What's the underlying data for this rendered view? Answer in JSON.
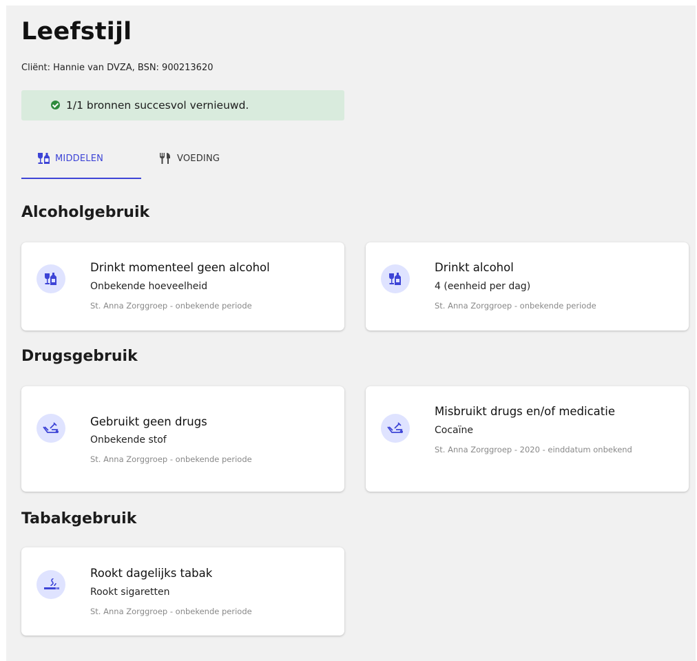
{
  "page": {
    "title": "Leefstijl",
    "client_info": "Cliënt: Hannie van DVZA, BSN: 900213620"
  },
  "alert": {
    "text": "1/1 bronnen succesvol vernieuwd.",
    "icon": "check-circle-icon",
    "color": "#2e8b3d",
    "background": "#d9ebdd"
  },
  "tabs": [
    {
      "label": "MIDDELEN",
      "icon": "bottle-glass-icon",
      "active": true
    },
    {
      "label": "VOEDING",
      "icon": "cutlery-icon",
      "active": false
    }
  ],
  "colors": {
    "accent": "#3d44d6",
    "icon_circle": "#dfe3ff"
  },
  "sections": {
    "alcohol": {
      "title": "Alcoholgebruik",
      "cards": [
        {
          "title": "Drinkt momenteel geen alcohol",
          "subtitle": "Onbekende hoeveelheid",
          "meta": "St. Anna Zorggroep - onbekende periode",
          "icon": "alcohol-icon"
        },
        {
          "title": "Drinkt alcohol",
          "subtitle": "4 (eenheid per dag)",
          "meta": "St. Anna Zorggroep - onbekende periode",
          "icon": "alcohol-icon"
        }
      ]
    },
    "drugs": {
      "title": "Drugsgebruik",
      "cards": [
        {
          "title": "Gebruikt geen drugs",
          "subtitle": "Onbekende stof",
          "meta": "St. Anna Zorggroep - onbekende periode",
          "icon": "drugs-icon"
        },
        {
          "title": "Misbruikt drugs en/of medicatie",
          "subtitle": "Cocaïne",
          "meta": "St. Anna Zorggroep - 2020 - einddatum onbekend",
          "icon": "drugs-icon"
        }
      ]
    },
    "tabak": {
      "title": "Tabakgebruik",
      "cards": [
        {
          "title": "Rookt dagelijks tabak",
          "subtitle": "Rookt sigaretten",
          "meta": "St. Anna Zorggroep - onbekende periode",
          "icon": "cigarette-icon"
        }
      ]
    }
  }
}
